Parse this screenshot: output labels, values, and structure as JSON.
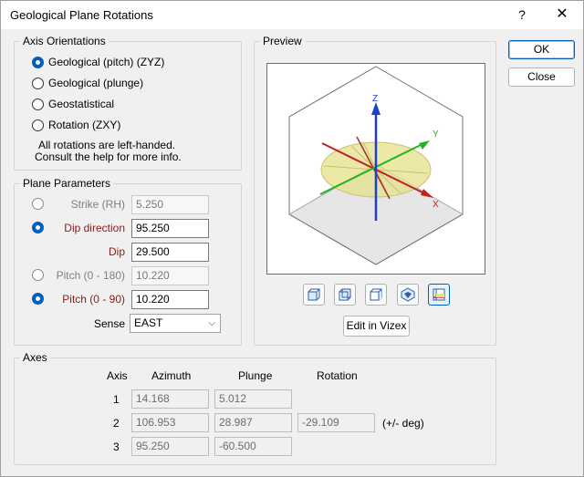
{
  "window": {
    "title": "Geological Plane Rotations",
    "help_glyph": "?",
    "close_glyph": "✕"
  },
  "axis_orientations": {
    "legend": "Axis Orientations",
    "options": [
      {
        "label": "Geological (pitch) (ZYZ)",
        "selected": true
      },
      {
        "label": "Geological (plunge)",
        "selected": false
      },
      {
        "label": "Geostatistical",
        "selected": false
      },
      {
        "label": "Rotation (ZXY)",
        "selected": false
      }
    ],
    "note_line1": "All rotations are left-handed.",
    "note_line2": "Consult the help for more info."
  },
  "plane_parameters": {
    "legend": "Plane Parameters",
    "strike": {
      "label": "Strike (RH)",
      "value": "5.250"
    },
    "dip_direction": {
      "label": "Dip direction",
      "value": "95.250"
    },
    "dip": {
      "label": "Dip",
      "value": "29.500"
    },
    "pitch_180": {
      "label": "Pitch (0 - 180)",
      "value": "10.220"
    },
    "pitch_90": {
      "label": "Pitch (0 - 90)",
      "value": "10.220"
    },
    "sense": {
      "label": "Sense",
      "value": "EAST"
    }
  },
  "preview": {
    "legend": "Preview",
    "axis_z": "Z",
    "axis_y": "Y",
    "axis_x": "X",
    "toolbar_icons": [
      "view-front-icon",
      "view-iso-icon",
      "view-side-icon",
      "view-rotate-icon",
      "view-plane-icon"
    ],
    "edit_button": "Edit in Vizex",
    "colors": {
      "z": "#1a3fd1",
      "y": "#22b422",
      "x": "#d42020",
      "plane": "#e6e08a"
    }
  },
  "buttons": {
    "ok": "OK",
    "close": "Close"
  },
  "axes": {
    "legend": "Axes",
    "headers": {
      "axis": "Axis",
      "azimuth": "Azimuth",
      "plunge": "Plunge",
      "rotation": "Rotation"
    },
    "rows": [
      {
        "axis": "1",
        "azimuth": "14.168",
        "plunge": "5.012",
        "rotation": ""
      },
      {
        "axis": "2",
        "azimuth": "106.953",
        "plunge": "28.987",
        "rotation": "-29.109"
      },
      {
        "axis": "3",
        "azimuth": "95.250",
        "plunge": "-60.500",
        "rotation": ""
      }
    ],
    "rotation_unit": "(+/- deg)"
  }
}
